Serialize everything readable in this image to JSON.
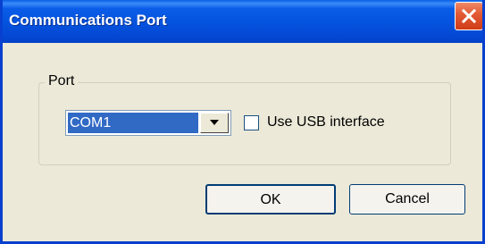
{
  "window": {
    "title": "Communications Port",
    "close_icon": "close-x-icon"
  },
  "port_group": {
    "legend": "Port",
    "combo": {
      "selected": "COM1",
      "arrow_icon": "dropdown-arrow-icon"
    },
    "usb_checkbox": {
      "label": "Use USB interface",
      "checked": false
    }
  },
  "buttons": {
    "ok_label": "OK",
    "cancel_label": "Cancel"
  },
  "colors": {
    "titlebar": "#0554df",
    "window_bg": "#ece9d8",
    "close_button": "#e35c36",
    "selection": "#316ac5"
  }
}
